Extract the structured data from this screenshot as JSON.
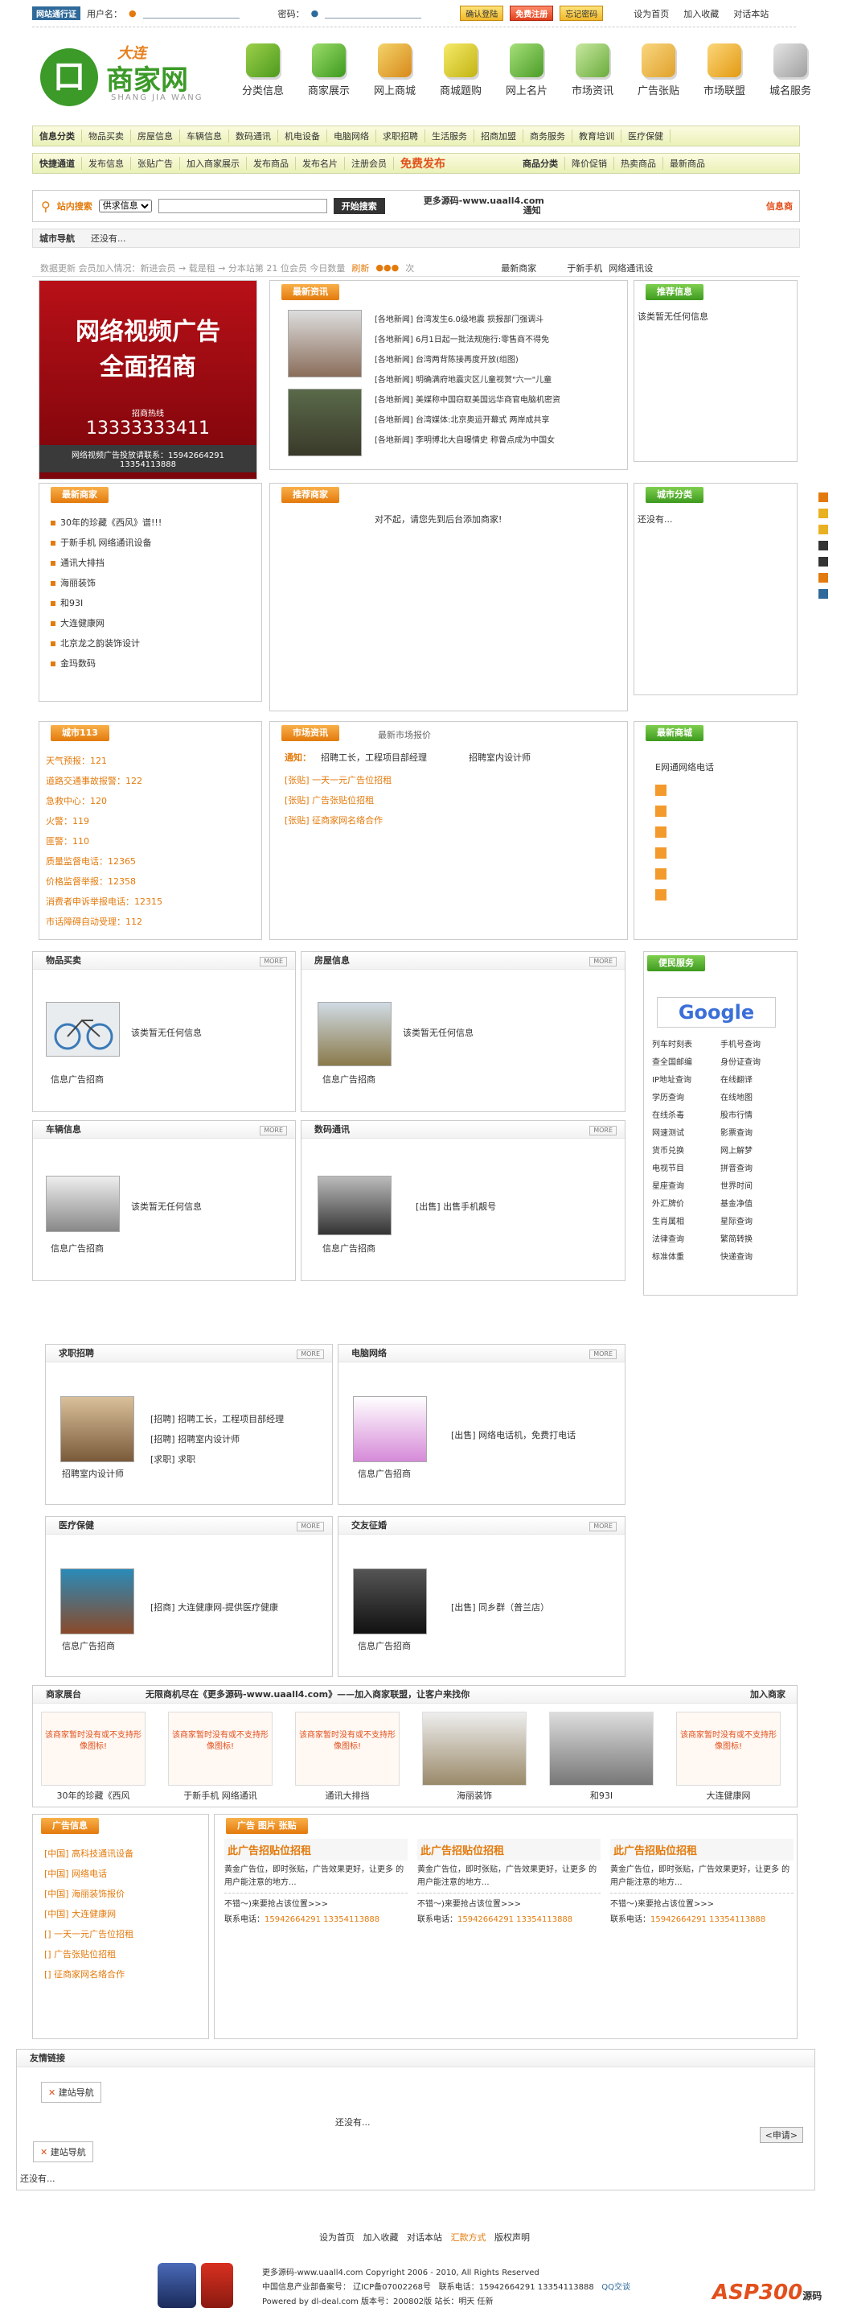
{
  "login": {
    "badge": "网站通行证",
    "user_label": "用户名：",
    "pwd_label": "密码：",
    "login_btn": "确认登陆",
    "register_btn": "免费注册",
    "forgot_btn": "忘记密码",
    "links": [
      "设为首页",
      "加入收藏",
      "对话本站"
    ]
  },
  "logo": {
    "tag": "大连",
    "name": "商家网",
    "pinyin": "SHANG JIA WANG"
  },
  "nav": [
    "分类信息",
    "商家展示",
    "网上商城",
    "商城题购",
    "网上名片",
    "市场资讯",
    "广告张贴",
    "市场联盟",
    "城名服务"
  ],
  "cat1": {
    "label": "信息分类",
    "items": [
      "物品买卖",
      "房屋信息",
      "车辆信息",
      "数码通讯",
      "机电设备",
      "电脑网络",
      "求职招聘",
      "生活服务",
      "招商加盟",
      "商务服务",
      "教育培训",
      "医疗保健"
    ]
  },
  "cat2": {
    "label": "快捷通道",
    "items": [
      "发布信息",
      "张贴广告",
      "加入商家展示",
      "发布商品",
      "发布名片",
      "注册会员"
    ],
    "free": "免费发布",
    "shop_label": "商品分类",
    "shop_items": [
      "降价促销",
      "热卖商品",
      "最新商品"
    ]
  },
  "search": {
    "label": "站内搜索",
    "select": "供求信息",
    "button": "开始搜索",
    "hot": "更多源码-www.uaall4.com",
    "notice": "通知",
    "right": "信息商"
  },
  "marquee": {
    "label": "城市导航",
    "text": "还没有..."
  },
  "stats": {
    "text": "数据更新  会员加入情况：新进会员 → 载是租 → 分本站第 21 位会员  今日数量",
    "refresh": "刷新",
    "suffix": "次",
    "newest_label": "最新商家",
    "newest_items": [
      "于新手机",
      "网络通讯设"
    ]
  },
  "banner": {
    "title1": "网络视频广告",
    "title2": "全面招商",
    "hotline_label": "招商热线",
    "hotline": "13333333411",
    "contact": "网络视频广告投放请联系：15942664291",
    "contact2": "13354113888"
  },
  "news": {
    "title": "最新资讯",
    "items": [
      "[各地新闻] 台湾发生6.0级地震 损报部门强调斗",
      "[各地新闻] 6月1日起一批法规施行:零售商不得免",
      "[各地新闻] 台湾两背陈接再度开放(组图)",
      "[各地新闻] 明确满府地震灾区儿童视贺\"六一\"儿童",
      "[各地新闻] 美媒称中国窃取美国远华商官电脑机密资",
      "[各地新闻] 台湾媒体:北京奥运开幕式 两岸成共享",
      "[各地新闻] 李明博北大自曝情史 称曾点成为中国女"
    ]
  },
  "recommend": {
    "title": "推荐信息",
    "text": "该类暂无任何信息"
  },
  "merchants": {
    "title": "最新商家",
    "items": [
      "30年的珍藏《西风》谱!!!",
      "于新手机 网络通讯设备",
      "通讯大排挡",
      "海丽装饰",
      "和93I",
      "大连健康网",
      "北京龙之韵装饰设计",
      "金玛数码"
    ]
  },
  "promo": {
    "title": "推荐商家",
    "text": "对不起，请您先到后台添加商家!"
  },
  "city": {
    "title": "城市分类",
    "text": "还没有..."
  },
  "phones": {
    "title": "城市113",
    "items": [
      "天气预报：121",
      "道路交通事故报警：122",
      "急救中心：120",
      "火警：119",
      "匪警：110",
      "质量监督电话：12365",
      "价格监督举报：12358",
      "消费者申诉举报电话：12315",
      "市话障碍自动受理：112"
    ]
  },
  "market": {
    "tab1": "市场资讯",
    "tab2": "最新市场报价",
    "label": "通知：",
    "marquee": "招聘工长，工程项目部经理",
    "marquee2": "招聘室内设计师",
    "items": [
      "[张贴] 一天一元广告位招租",
      "[张贴] 广告张贴位招租",
      "[张贴] 征商家网名络合作"
    ]
  },
  "hotshops": {
    "title": "最新商城",
    "first": "E网通网络电话"
  },
  "sections": [
    {
      "title": "物品买卖",
      "text": "该类暂无任何信息",
      "caption": "信息广告招商"
    },
    {
      "title": "房屋信息",
      "text": "该类暂无任何信息",
      "caption": "信息广告招商"
    },
    {
      "title": "车辆信息",
      "text": "该类暂无任何信息",
      "caption": "信息广告招商"
    },
    {
      "title": "数码通讯",
      "text": "[出售] 出售手机靓号",
      "caption": "信息广告招商"
    }
  ],
  "more_label": "MORE",
  "convenience": {
    "title": "便民服务",
    "google": "Google",
    "items": [
      "列车时刻表",
      "手机号查询",
      "查全国邮编",
      "身份证查询",
      "IP地址查询",
      "在线翻译",
      "学历查询",
      "在线地图",
      "在线杀毒",
      "股市行情",
      "网速测试",
      "影票查询",
      "货币兑换",
      "网上解梦",
      "电视节目",
      "拼音查询",
      "星座查询",
      "世界时间",
      "外汇牌价",
      "基金净值",
      "生肖属相",
      "星际查询",
      "法律查询",
      "繁简转换",
      "标准体重",
      "快递查询"
    ]
  },
  "sections2": [
    {
      "title": "求职招聘",
      "items": [
        "[招聘] 招聘工长，工程项目部经理",
        "[招聘] 招聘室内设计师",
        "[求职] 求职"
      ],
      "caption": "招聘室内设计师"
    },
    {
      "title": "电脑网络",
      "items": [
        "[出售] 网络电话机，免费打电话"
      ],
      "caption": "信息广告招商"
    },
    {
      "title": "医疗保健",
      "items": [
        "[招商] 大连健康网-提供医疗健康"
      ],
      "caption": "信息广告招商"
    },
    {
      "title": "交友征婚",
      "items": [
        "[出售] 同乡群（普兰店）"
      ],
      "caption": "信息广告招商"
    }
  ],
  "showcase": {
    "title": "商家展台",
    "slogan": "无限商机尽在《更多源码-www.uaall4.com》——加入商家联盟，让客户来找你",
    "join": "加入商家",
    "items": [
      "30年的珍藏《西风",
      "于新手机 网络通讯",
      "通讯大排挡",
      "海丽装饰",
      "和93I",
      "大连健康网"
    ],
    "placeholder": "该商家暂时没有或不支持形像图标!"
  },
  "ads": {
    "title": "广告信息",
    "items": [
      "[中国] 高科技通讯设备",
      "[中国] 网络电话",
      "[中国] 海丽装饰报价",
      "[中国] 大连健康网",
      "[] 一天一元广告位招租",
      "[] 广告张贴位招租",
      "[] 征商家网名络合作"
    ],
    "tab": "广告 图片 张贴",
    "cards": [
      {
        "title": "此广告招贴位招租",
        "text": "黄金广告位，即时张贴，广告效果更好，让更多 的用户能注意的地方...",
        "more": "不错～)来要抢占该位置>>>",
        "contact": "联系电话：",
        "phone": "15942664291 13354113888"
      },
      {
        "title": "此广告招贴位招租",
        "text": "黄金广告位，即时张贴，广告效果更好，让更多 的用户能注意的地方...",
        "more": "不错～)来要抢占该位置>>>",
        "contact": "联系电话：",
        "phone": "15942664291 13354113888"
      },
      {
        "title": "此广告招贴位招租",
        "text": "黄金广告位，即时张贴，广告效果更好，让更多 的用户能注意的地方...",
        "more": "不错～)来要抢占该位置>>>",
        "contact": "联系电话：",
        "phone": "15942664291 13354113888"
      }
    ]
  },
  "friends": {
    "title": "友情链接",
    "item": "建站导航",
    "text": "还没有...",
    "apply": "<申请>",
    "text2": "还没有..."
  },
  "footer": {
    "links": [
      "设为首页",
      "加入收藏",
      "对话本站",
      "汇款方式",
      "版权声明"
    ],
    "copy": "更多源码-www.uaall4.com Copyright 2006 - 2010, All Rights Reserved",
    "icp": "中国信息产业部备案号： 辽ICP备07002268号",
    "contact": "联系电话：15942664291 13354113888",
    "qq": "QQ交谈",
    "powered": "Powered by dl-deal.com  版本号：200802版 站长：明天 任新",
    "brand": "ASP300",
    "brand2": "源码"
  }
}
